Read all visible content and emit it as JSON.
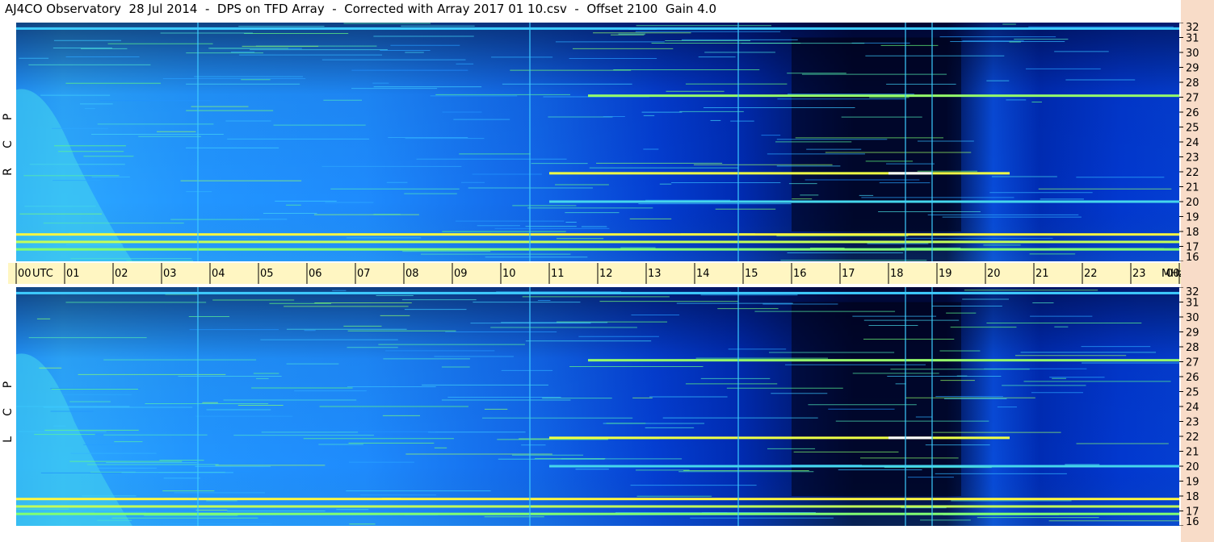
{
  "title": "AJ4CO Observatory  28 Jul 2014  -  DPS on TFD Array  -  Corrected with Array 2017 01 10.csv  -  Offset 2100  Gain 4.0",
  "chart_data": {
    "type": "heatmap",
    "title": "AJ4CO Observatory  28 Jul 2014  -  DPS on TFD Array  -  Corrected with Array 2017 01 10.csv  -  Offset 2100  Gain 4.0",
    "x_axis": {
      "unit_label": "UTC",
      "tick_labels": [
        "00",
        "01",
        "02",
        "03",
        "04",
        "05",
        "06",
        "07",
        "08",
        "09",
        "10",
        "11",
        "12",
        "13",
        "14",
        "15",
        "16",
        "17",
        "18",
        "19",
        "20",
        "21",
        "22",
        "23",
        "00"
      ],
      "range_hours": [
        0,
        24
      ]
    },
    "y_axis": {
      "unit_label": "MHz",
      "tick_labels": [
        "32",
        "31",
        "30",
        "29",
        "28",
        "27",
        "26",
        "25",
        "24",
        "23",
        "22",
        "21",
        "20",
        "19",
        "18",
        "17",
        "16"
      ],
      "range_mhz": [
        16,
        32
      ]
    },
    "panels": [
      {
        "polarization": [
          "R",
          "C",
          "P"
        ]
      },
      {
        "polarization": [
          "L",
          "C",
          "P"
        ]
      }
    ],
    "colormap": [
      "#000a38",
      "#0033cc",
      "#1f8fff",
      "#40d0ff",
      "#60ff80",
      "#ffff40",
      "#ff4060",
      "#ffffff"
    ],
    "features": {
      "rfi_bands_mhz": [
        {
          "freq": 27.1,
          "from_h": 11.8,
          "to_h": 24,
          "intensity": 0.62
        },
        {
          "freq": 21.9,
          "from_h": 11.0,
          "to_h": 20.5,
          "intensity": 0.7
        },
        {
          "freq": 21.9,
          "from_h": 18.0,
          "to_h": 18.9,
          "intensity": 1.0
        },
        {
          "freq": 17.8,
          "from_h": 0,
          "to_h": 24,
          "intensity": 0.72
        },
        {
          "freq": 17.3,
          "from_h": 0,
          "to_h": 24,
          "intensity": 0.66
        },
        {
          "freq": 16.8,
          "from_h": 0,
          "to_h": 24,
          "intensity": 0.6
        },
        {
          "freq": 20.0,
          "from_h": 11.0,
          "to_h": 24,
          "intensity": 0.45
        },
        {
          "freq": 31.6,
          "from_h": 0,
          "to_h": 24,
          "intensity": 0.42
        }
      ],
      "vertical_lines_h": [
        3.75,
        10.6,
        14.9,
        18.35,
        18.9
      ],
      "night_dark_region_h": [
        16.0,
        19.5
      ]
    }
  }
}
